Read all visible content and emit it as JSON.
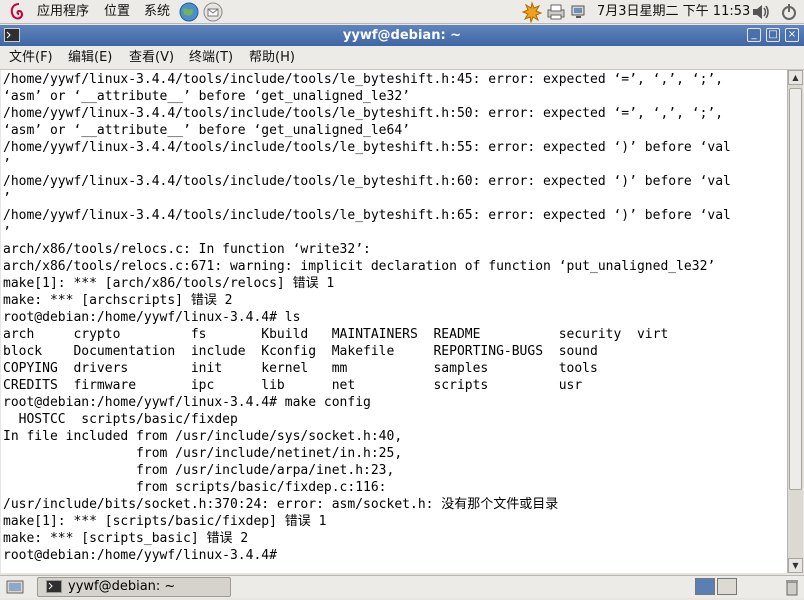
{
  "top_panel": {
    "applications": "应用程序",
    "places": "位置",
    "system": "系统",
    "clock": "7月3日星期二 下午 11:53"
  },
  "window": {
    "title": "yywf@debian: ~",
    "menu": [
      "文件(F)",
      "编辑(E)",
      "查看(V)",
      "终端(T)",
      "帮助(H)"
    ]
  },
  "terminal": {
    "lines": [
      "/home/yywf/linux-3.4.4/tools/include/tools/le_byteshift.h:45: error: expected ‘=’, ‘,’, ‘;’,",
      "‘asm’ or ‘__attribute__’ before ‘get_unaligned_le32’",
      "/home/yywf/linux-3.4.4/tools/include/tools/le_byteshift.h:50: error: expected ‘=’, ‘,’, ‘;’,",
      "‘asm’ or ‘__attribute__’ before ‘get_unaligned_le64’",
      "/home/yywf/linux-3.4.4/tools/include/tools/le_byteshift.h:55: error: expected ‘)’ before ‘val",
      "’",
      "/home/yywf/linux-3.4.4/tools/include/tools/le_byteshift.h:60: error: expected ‘)’ before ‘val",
      "’",
      "/home/yywf/linux-3.4.4/tools/include/tools/le_byteshift.h:65: error: expected ‘)’ before ‘val",
      "’",
      "arch/x86/tools/relocs.c: In function ‘write32’:",
      "arch/x86/tools/relocs.c:671: warning: implicit declaration of function ‘put_unaligned_le32’",
      "make[1]: *** [arch/x86/tools/relocs] 错误 1",
      "make: *** [archscripts] 错误 2",
      "root@debian:/home/yywf/linux-3.4.4# ls",
      "arch     crypto         fs       Kbuild   MAINTAINERS  README          security  virt",
      "block    Documentation  include  Kconfig  Makefile     REPORTING-BUGS  sound",
      "COPYING  drivers        init     kernel   mm           samples         tools",
      "CREDITS  firmware       ipc      lib      net          scripts         usr",
      "root@debian:/home/yywf/linux-3.4.4# make config",
      "  HOSTCC  scripts/basic/fixdep",
      "In file included from /usr/include/sys/socket.h:40,",
      "                 from /usr/include/netinet/in.h:25,",
      "                 from /usr/include/arpa/inet.h:23,",
      "                 from scripts/basic/fixdep.c:116:",
      "/usr/include/bits/socket.h:370:24: error: asm/socket.h: 没有那个文件或目录",
      "make[1]: *** [scripts/basic/fixdep] 错误 1",
      "make: *** [scripts_basic] 错误 2",
      "root@debian:/home/yywf/linux-3.4.4#"
    ]
  },
  "taskbar": {
    "item_label": "yywf@debian: ~"
  }
}
